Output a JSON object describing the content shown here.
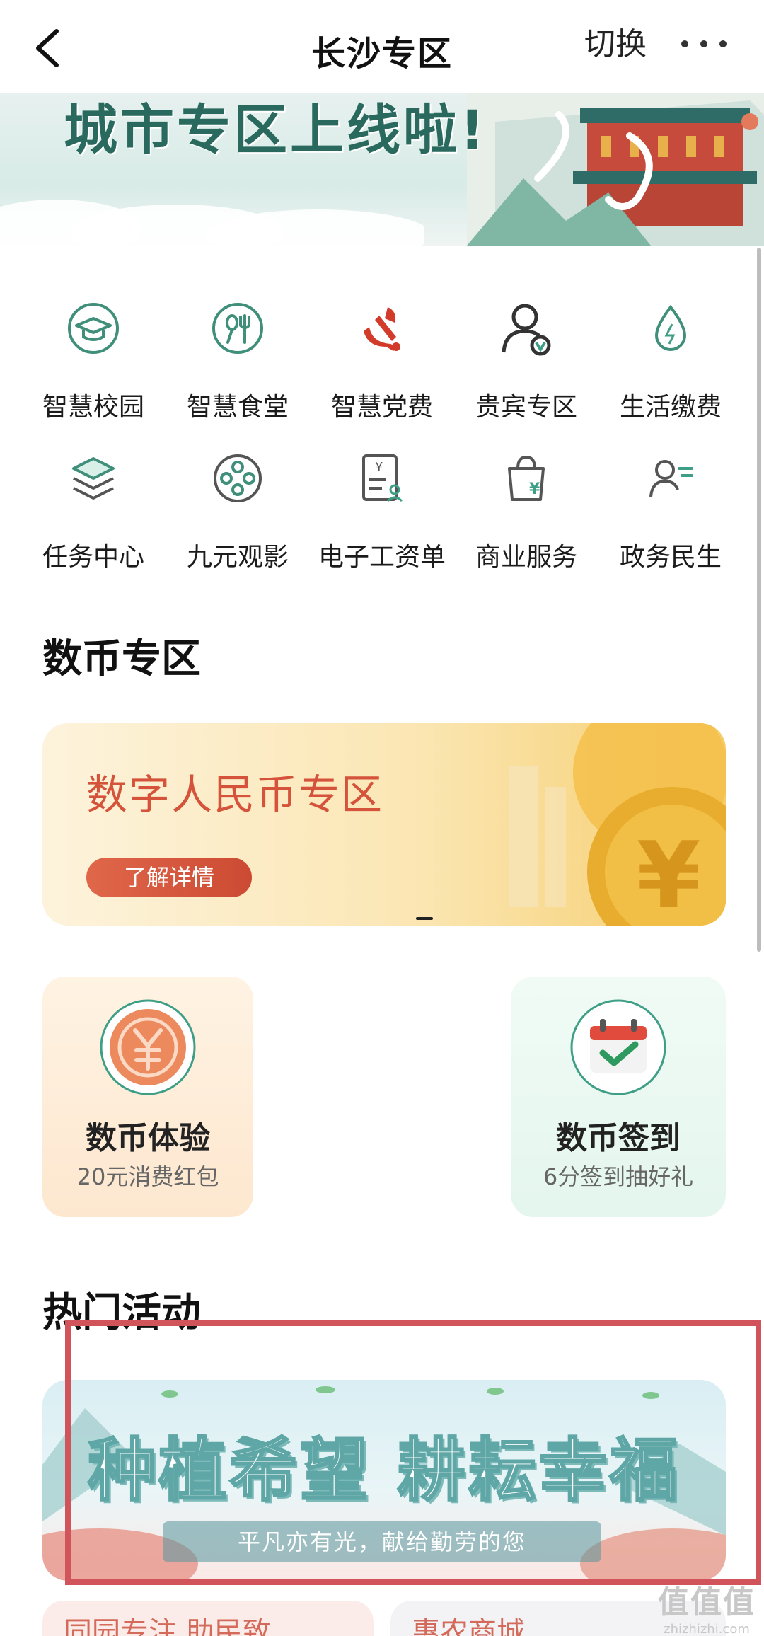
{
  "header": {
    "title": "长沙专区",
    "switch_label": "切换"
  },
  "hero": {
    "headline": "城市专区上线啦!"
  },
  "services": [
    {
      "label": "智慧校园",
      "icon": "graduation-cap-icon"
    },
    {
      "label": "智慧食堂",
      "icon": "fork-knife-icon"
    },
    {
      "label": "智慧党费",
      "icon": "party-emblem-icon"
    },
    {
      "label": "贵宾专区",
      "icon": "vip-user-icon"
    },
    {
      "label": "生活缴费",
      "icon": "water-drop-icon"
    },
    {
      "label": "任务中心",
      "icon": "layers-icon"
    },
    {
      "label": "九元观影",
      "icon": "film-reel-icon"
    },
    {
      "label": "电子工资单",
      "icon": "payslip-icon"
    },
    {
      "label": "商业服务",
      "icon": "shopping-bag-icon"
    },
    {
      "label": "政务民生",
      "icon": "person-list-icon"
    }
  ],
  "digital_currency": {
    "section_title": "数币专区",
    "banner_title": "数字人民币专区",
    "banner_button": "了解详情",
    "cards": [
      {
        "title": "数币体验",
        "subtitle": "20元消费红包",
        "icon": "yuan-coin-icon"
      },
      {
        "title": "数币签到",
        "subtitle": "6分签到抽好礼",
        "icon": "calendar-check-icon"
      }
    ]
  },
  "hot_activities": {
    "section_title": "热门活动",
    "banner_title": "种植希望 耕耘幸福",
    "banner_subtitle": "平凡亦有光，献给勤劳的您"
  },
  "bottom_cards": [
    {
      "text": "同园专注 助民致"
    },
    {
      "text": "惠农商城"
    }
  ],
  "watermark": {
    "main": "值值值",
    "sub": "zhizhizhi.com"
  },
  "colors": {
    "brand_green": "#3f9f86",
    "party_red": "#d23a2a",
    "highlight_red": "#d1545a"
  }
}
